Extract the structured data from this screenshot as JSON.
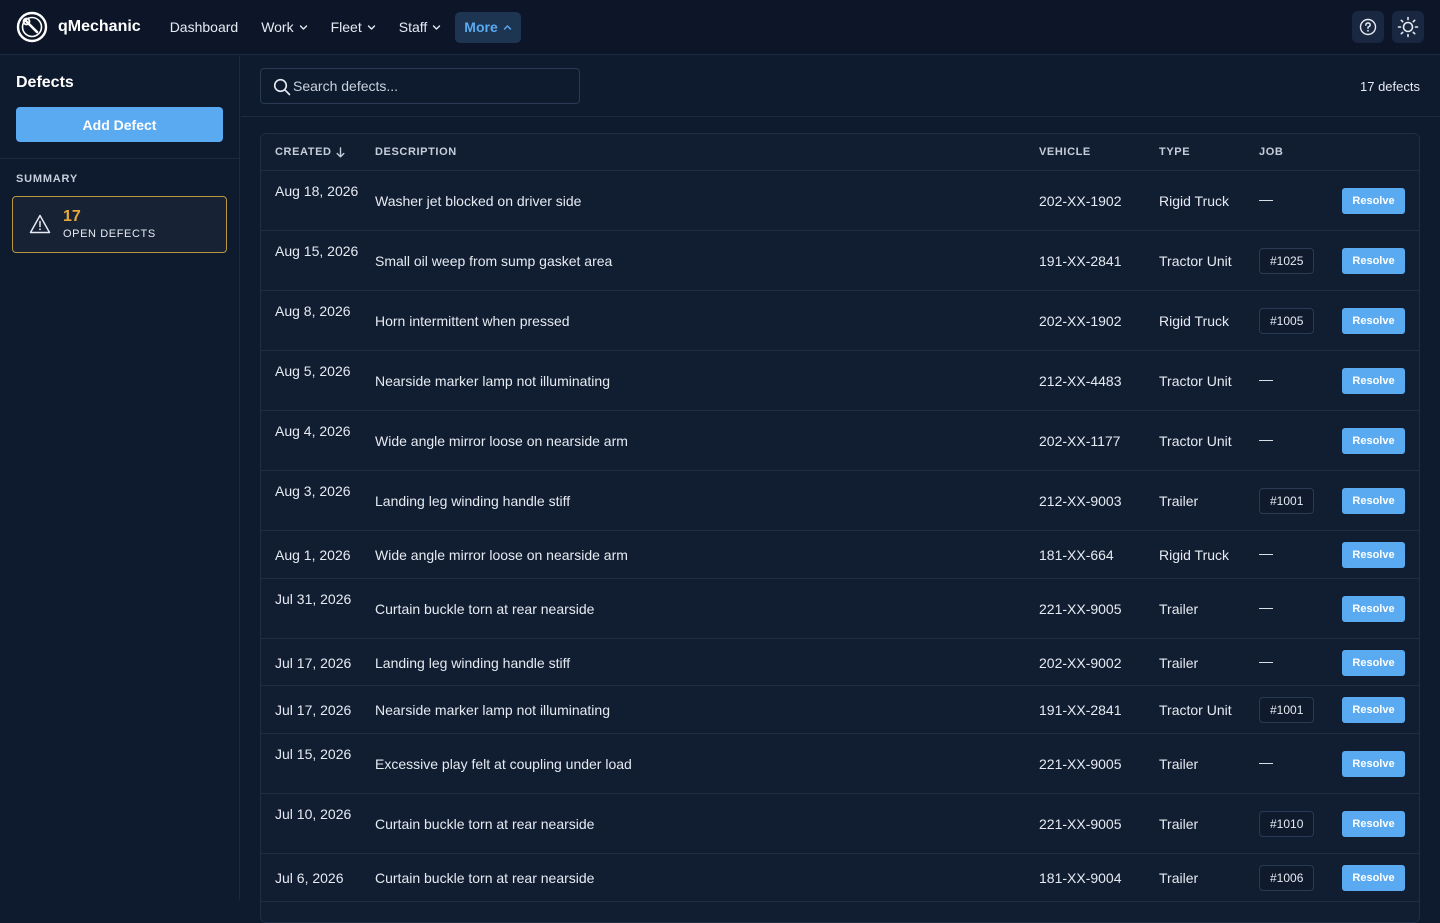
{
  "app": {
    "name": "qMechanic",
    "nav": [
      {
        "label": "Dashboard",
        "dropdown": false,
        "active": false
      },
      {
        "label": "Work",
        "dropdown": true,
        "active": false
      },
      {
        "label": "Fleet",
        "dropdown": true,
        "active": false
      },
      {
        "label": "Staff",
        "dropdown": true,
        "active": false
      },
      {
        "label": "More",
        "dropdown": true,
        "active": true
      }
    ],
    "actions": [
      "help-icon",
      "sun-icon"
    ],
    "accent_color": "#5aaaf2",
    "warning_color": "#e8a93a"
  },
  "sidebar": {
    "title": "Defects",
    "add_button": "Add Defect",
    "summary_label": "SUMMARY",
    "summary_count": "17",
    "summary_text": "OPEN DEFECTS"
  },
  "main": {
    "search_placeholder": "Search defects...",
    "count_text": "17 defects",
    "columns": {
      "created": "CREATED",
      "description": "DESCRIPTION",
      "vehicle": "VEHICLE",
      "type": "TYPE",
      "job": "JOB"
    },
    "rows": [
      {
        "created": "Aug 18, 2026",
        "description": "Washer jet blocked on driver side",
        "vehicle": "202-XX-1902",
        "type": "Rigid Truck",
        "job": "—",
        "action": "Resolve"
      },
      {
        "created": "Aug 15, 2026",
        "description": "Small oil weep from sump gasket area",
        "vehicle": "191-XX-2841",
        "type": "Tractor Unit",
        "job": "#1025",
        "action": "Resolve"
      },
      {
        "created": "Aug 8, 2026",
        "description": "Horn intermittent when pressed",
        "vehicle": "202-XX-1902",
        "type": "Rigid Truck",
        "job": "#1005",
        "action": "Resolve"
      },
      {
        "created": "Aug 5, 2026",
        "description": "Nearside marker lamp not illuminating",
        "vehicle": "212-XX-4483",
        "type": "Tractor Unit",
        "job": "—",
        "action": "Resolve"
      },
      {
        "created": "Aug 4, 2026",
        "description": "Wide angle mirror loose on nearside arm",
        "vehicle": "202-XX-1177",
        "type": "Tractor Unit",
        "job": "—",
        "action": "Resolve"
      },
      {
        "created": "Aug 3, 2026",
        "description": "Landing leg winding handle stiff",
        "vehicle": "212-XX-9003",
        "type": "Trailer",
        "job": "#1001",
        "action": "Resolve"
      },
      {
        "created": "Aug 1, 2026",
        "description": "Wide angle mirror loose on nearside arm",
        "vehicle": "181-XX-664",
        "type": "Rigid Truck",
        "job": "—",
        "action": "Resolve"
      },
      {
        "created": "Jul 31, 2026",
        "description": "Curtain buckle torn at rear nearside",
        "vehicle": "221-XX-9005",
        "type": "Trailer",
        "job": "—",
        "action": "Resolve"
      },
      {
        "created": "Jul 17, 2026",
        "description": "Landing leg winding handle stiff",
        "vehicle": "202-XX-9002",
        "type": "Trailer",
        "job": "—",
        "action": "Resolve"
      },
      {
        "created": "Jul 17, 2026",
        "description": "Nearside marker lamp not illuminating",
        "vehicle": "191-XX-2841",
        "type": "Tractor Unit",
        "job": "#1001",
        "action": "Resolve"
      },
      {
        "created": "Jul 15, 2026",
        "description": "Excessive play felt at coupling under load",
        "vehicle": "221-XX-9005",
        "type": "Trailer",
        "job": "—",
        "action": "Resolve"
      },
      {
        "created": "Jul 10, 2026",
        "description": "Curtain buckle torn at rear nearside",
        "vehicle": "221-XX-9005",
        "type": "Trailer",
        "job": "#1010",
        "action": "Resolve"
      },
      {
        "created": "Jul 6, 2026",
        "description": "Curtain buckle torn at rear nearside",
        "vehicle": "181-XX-9004",
        "type": "Trailer",
        "job": "#1006",
        "action": "Resolve"
      }
    ]
  }
}
